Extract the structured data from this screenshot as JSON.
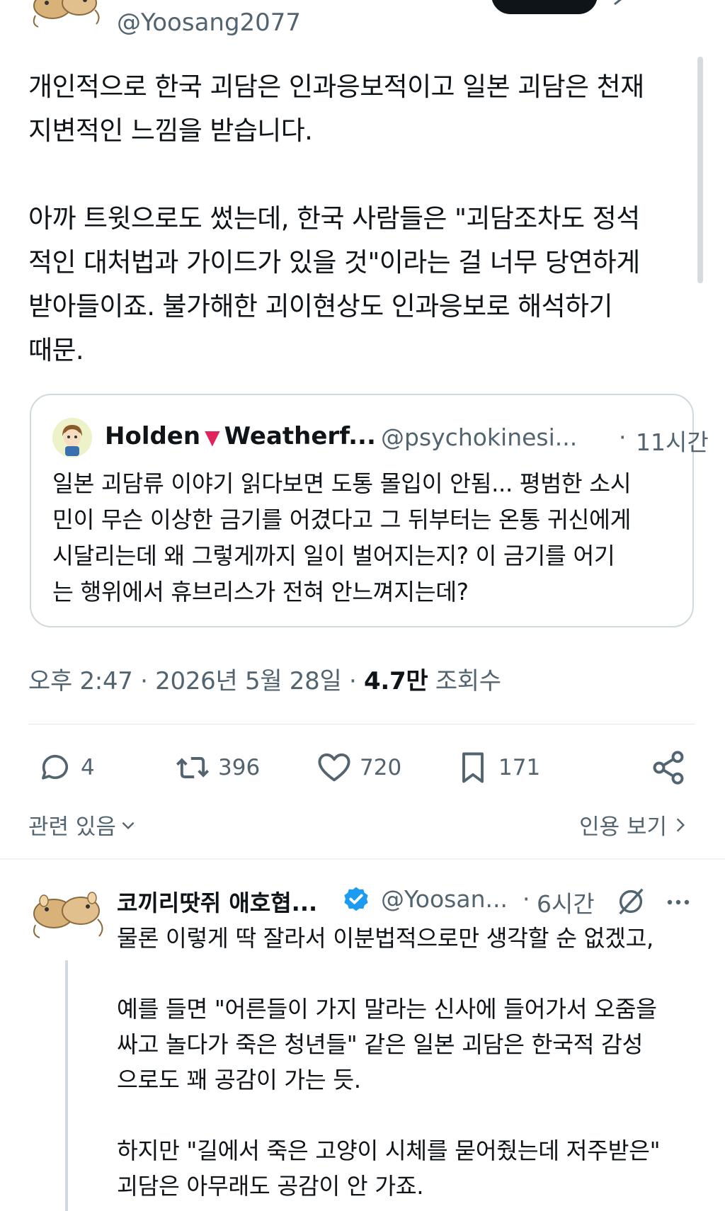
{
  "top": {
    "handle": "@Yoosang2077"
  },
  "tweet": {
    "paragraphs": [
      [
        "개인적으로 한국 괴담은 인과응보적이고 일본 괴담은 천재",
        "지변적인 느낌을 받습니다."
      ],
      [
        "아까 트윗으로도 썼는데, 한국 사람들은 \"괴담조차도 정석",
        "적인 대처법과 가이드가 있을 것\"이라는 걸 너무 당연하게",
        "받아들이죠. 불가해한 괴이현상도 인과응보로 해석하기",
        "때문."
      ]
    ]
  },
  "quote": {
    "name_first": "Holden",
    "name_rest": "Weatherf...",
    "handle": "@psychokinesi...",
    "separator": "·",
    "time": "11시간",
    "lines": [
      "일본 괴담류 이야기 읽다보면 도통 몰입이 안됨... 평범한 소시",
      "민이 무슨 이상한 금기를 어겼다고 그 뒤부터는 온통 귀신에게",
      "시달리는데 왜 그렇게까지 일이 벌어지는지? 이 금기를 어기",
      "는 행위에서 휴브리스가 전혀 안느껴지는데?"
    ]
  },
  "meta": {
    "time": "오후 2:47",
    "sep1": "·",
    "date": "2026년 5월 28일",
    "sep2": "·",
    "views_count": "4.7만",
    "views_label": "조회수"
  },
  "actions": {
    "replies": "4",
    "reposts": "396",
    "likes": "720",
    "bookmarks": "171"
  },
  "related": {
    "label": "관련 있음",
    "quotes_label": "인용 보기"
  },
  "reply": {
    "name": "코끼리땃쥐 애호협...",
    "handle": "@Yoosan...",
    "separator": "·",
    "time": "6시간",
    "paragraphs": [
      [
        "물론 이렇게 딱 잘라서 이분법적으로만 생각할 순 없겠고,"
      ],
      [
        "예를 들면 \"어른들이 가지 말라는 신사에 들어가서 오줌을",
        "싸고 놀다가 죽은 청년들\" 같은 일본 괴담은 한국적 감성",
        "으로도 꽤 공감이 가는 듯."
      ],
      [
        "하지만 \"길에서 죽은 고양이 시체를 묻어줬는데 저주받은\"",
        "괴담은 아무래도 공감이 안 가죠."
      ]
    ]
  },
  "colors": {
    "text": "#0f1419",
    "secondary": "#536471",
    "border": "#cfd9de",
    "verified": "#1d9bf0",
    "heart": "#e0245e"
  },
  "icons": {
    "reply": "speech-bubble-icon",
    "repost": "repost-arrows-icon",
    "like": "heart-icon",
    "bookmark": "bookmark-icon",
    "share": "share-nodes-icon",
    "verified": "verified-badge-icon",
    "grok": "grok-slash-icon",
    "more": "more-dots-icon"
  }
}
